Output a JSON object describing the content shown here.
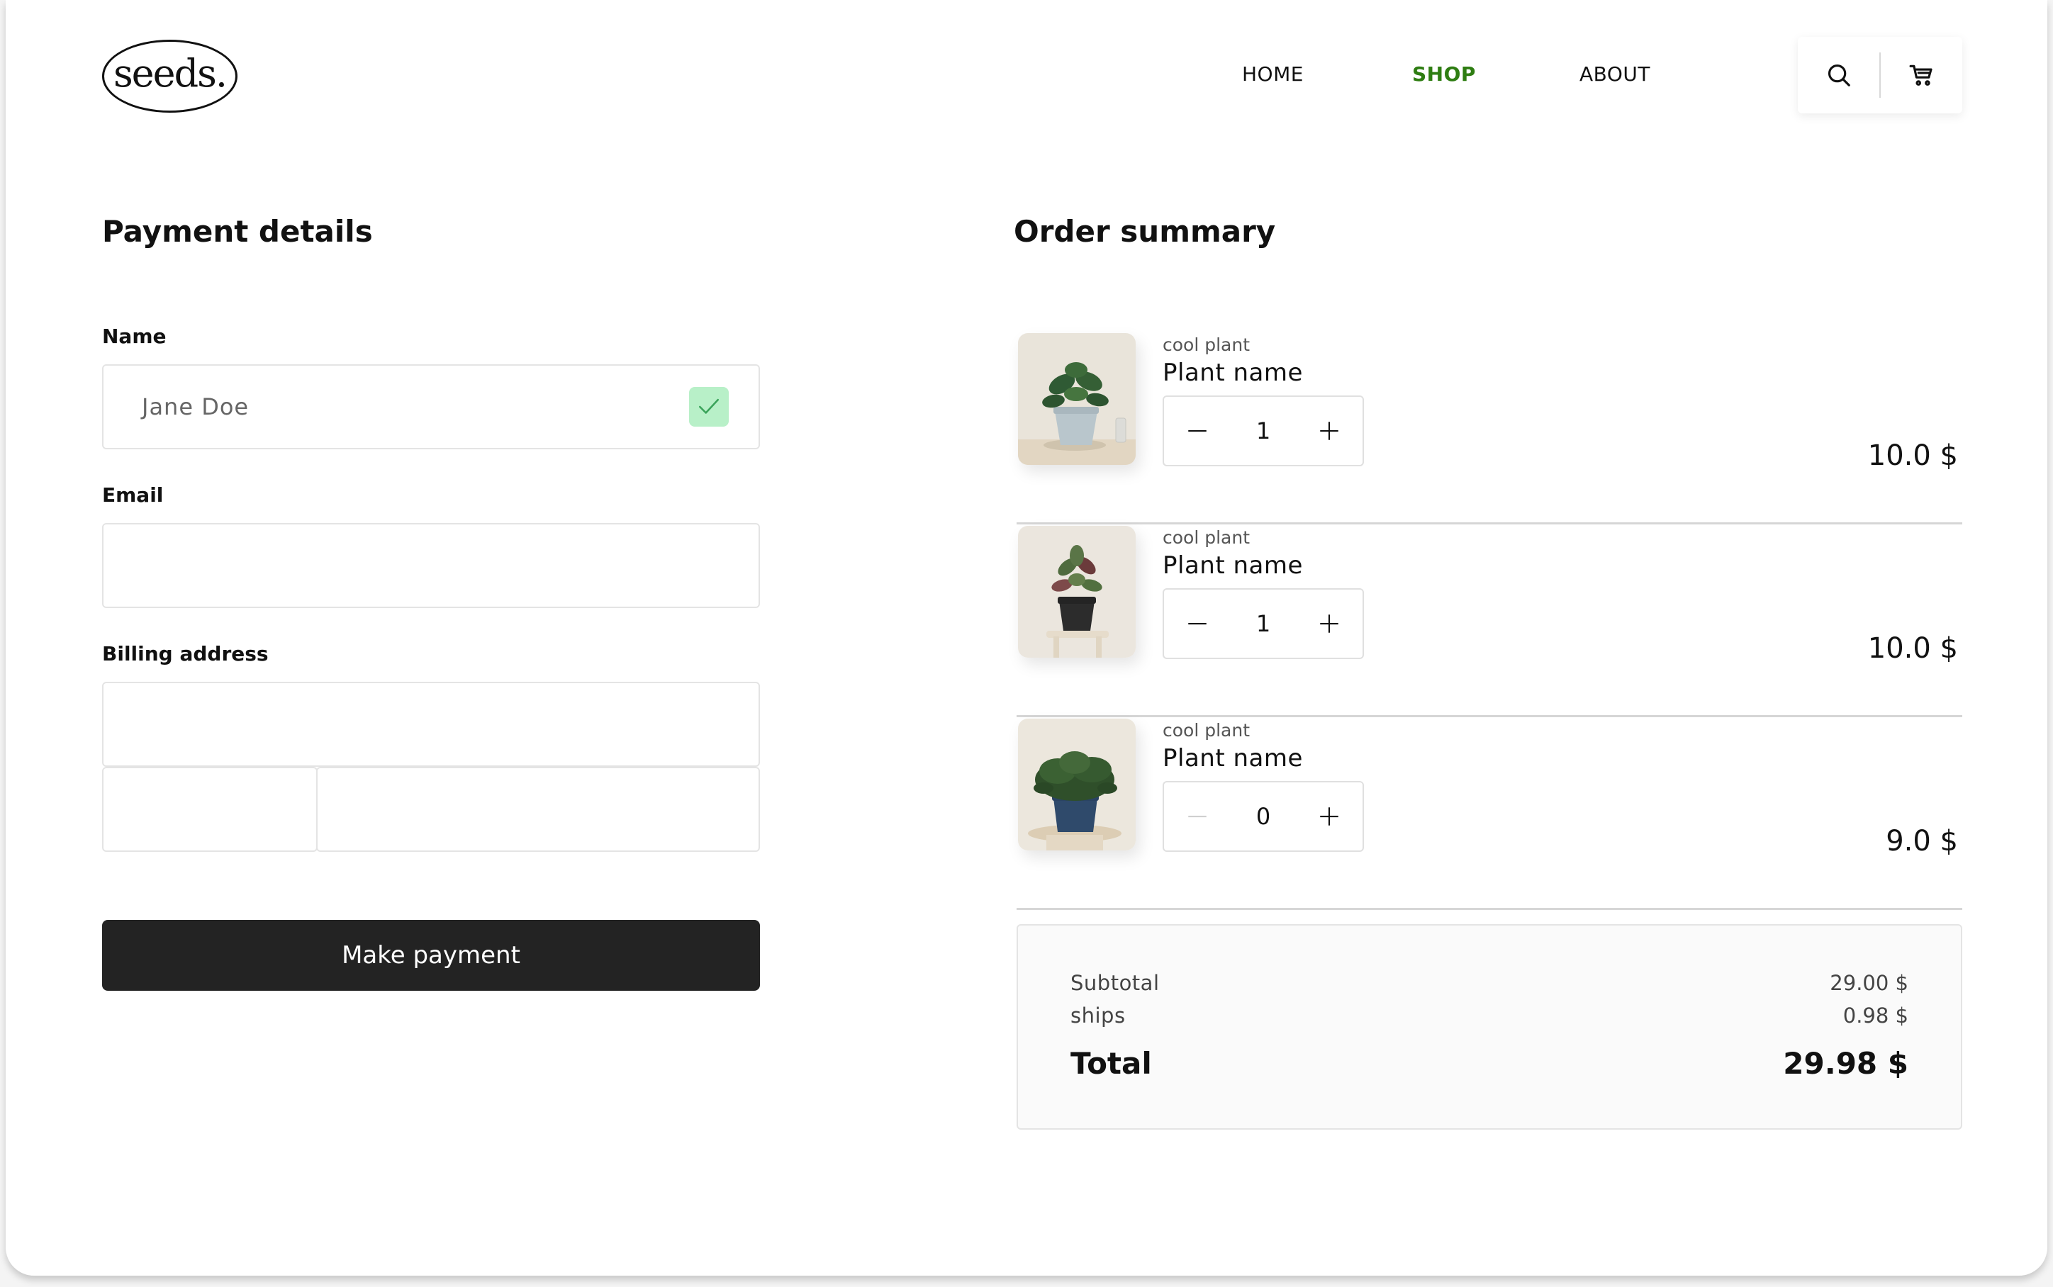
{
  "brand": {
    "logo_text": "seeds."
  },
  "nav": {
    "items": [
      {
        "label": "HOME",
        "active": false
      },
      {
        "label": "SHOP",
        "active": true
      },
      {
        "label": "ABOUT",
        "active": false
      }
    ],
    "search_icon": "search-icon",
    "cart_icon": "cart-icon"
  },
  "payment": {
    "title": "Payment details",
    "name_label": "Name",
    "name_value": "Jane Doe",
    "name_valid_icon": "check-icon",
    "email_label": "Email",
    "email_value": "",
    "billing_label": "Billing address",
    "billing_address_value": "",
    "billing_zip_value": "",
    "billing_city_value": "",
    "submit_label": "Make payment"
  },
  "order": {
    "title": "Order summary",
    "items": [
      {
        "subtitle": "cool plant",
        "name": "Plant name",
        "quantity": "1",
        "price": "10.0 $",
        "minus_enabled": true
      },
      {
        "subtitle": "cool plant",
        "name": "Plant name",
        "quantity": "1",
        "price": "10.0 $",
        "minus_enabled": true
      },
      {
        "subtitle": "cool plant",
        "name": "Plant name",
        "quantity": "0",
        "price": "9.0 $",
        "minus_enabled": false
      }
    ],
    "subtotal_label": "Subtotal",
    "subtotal_value": "29.00 $",
    "shipping_label": "ships",
    "shipping_value": "0.98 $",
    "total_label": "Total",
    "total_value": "29.98 $"
  },
  "colors": {
    "accent_green": "#2e7d12",
    "check_bg": "#b8f0c8",
    "button_dark": "#232323"
  }
}
